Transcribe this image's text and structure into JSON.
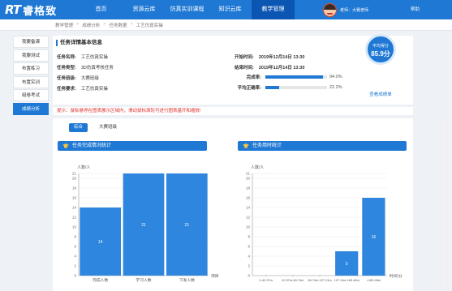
{
  "header": {
    "logo_rt": "RT",
    "logo_cn": "睿格致",
    "nav": [
      "首页",
      "资源云库",
      "仿真实训课程",
      "知识云库",
      "教学管理"
    ],
    "active_nav": 4,
    "user_name": "老师：大赛老师",
    "help": "帮助"
  },
  "breadcrumb": [
    "教学管理",
    "成绩分析",
    "任务数据",
    "工艺仿真实操"
  ],
  "sidebar": {
    "items": [
      "我要备课",
      "我要测试",
      "布置练习",
      "布置实训",
      "组卷考试",
      "成绩分析"
    ],
    "active": 5
  },
  "info": {
    "section_title": "任务详情基本信息",
    "fields": [
      {
        "label": "任务名称:",
        "value": "工艺仿真实操"
      },
      {
        "label": "任务类型:",
        "value": "3D仿真考核任务"
      },
      {
        "label": "任务班级:",
        "value": "大赛班级"
      },
      {
        "label": "任务要求:",
        "value": "工艺仿真实操"
      }
    ],
    "start_label": "开始时间:",
    "start_value": "2019年12月14日 13:30",
    "end_label": "结束时间:",
    "end_value": "2019年12月14日 13:30",
    "completion_label": "完成率:",
    "completion_pct": 94.0,
    "completion_text": "94.0%",
    "accuracy_label": "平均正确率:",
    "accuracy_pct": 22.2,
    "accuracy_text": "22.2%",
    "avg_score_label": "平均得分",
    "avg_score_value": "85.9分",
    "view_scores": "查看成绩单"
  },
  "tip": "提示：鼠标悬停在图表展示区域内，滑动鼠标滚轮可进行图表基开和缩放!",
  "tabs": [
    "综合",
    "大赛班级"
  ],
  "active_tab": 0,
  "colors": {
    "primary": "#1e78d4",
    "bar": "#2e86de",
    "tip": "#e0302c"
  },
  "chart_data": [
    {
      "type": "bar",
      "title": "任务完成情况统计",
      "ylabel": "人数/人",
      "xlabel": "项目",
      "categories": [
        "完成人数",
        "学习人数",
        "下发人数"
      ],
      "values": [
        14,
        21,
        21
      ],
      "ylim": [
        0,
        21
      ],
      "yticks": [
        0,
        2,
        4,
        6,
        8,
        10,
        12,
        14,
        16,
        18,
        20,
        21
      ],
      "grid": true
    },
    {
      "type": "bar",
      "title": "任务用时统计",
      "ylabel": "人数/人",
      "xlabel": "时间/分",
      "categories": [
        "0-42.37m",
        "42.37m-84.74m",
        "84.74m-127.11m",
        "127.11m-169.48m",
        ">169.48m"
      ],
      "values": [
        0,
        0,
        0,
        5,
        16
      ],
      "ylim": [
        0,
        21
      ],
      "yticks": [
        0,
        2,
        4,
        6,
        8,
        10,
        12,
        14,
        16,
        18,
        20,
        21
      ],
      "grid": true
    }
  ]
}
